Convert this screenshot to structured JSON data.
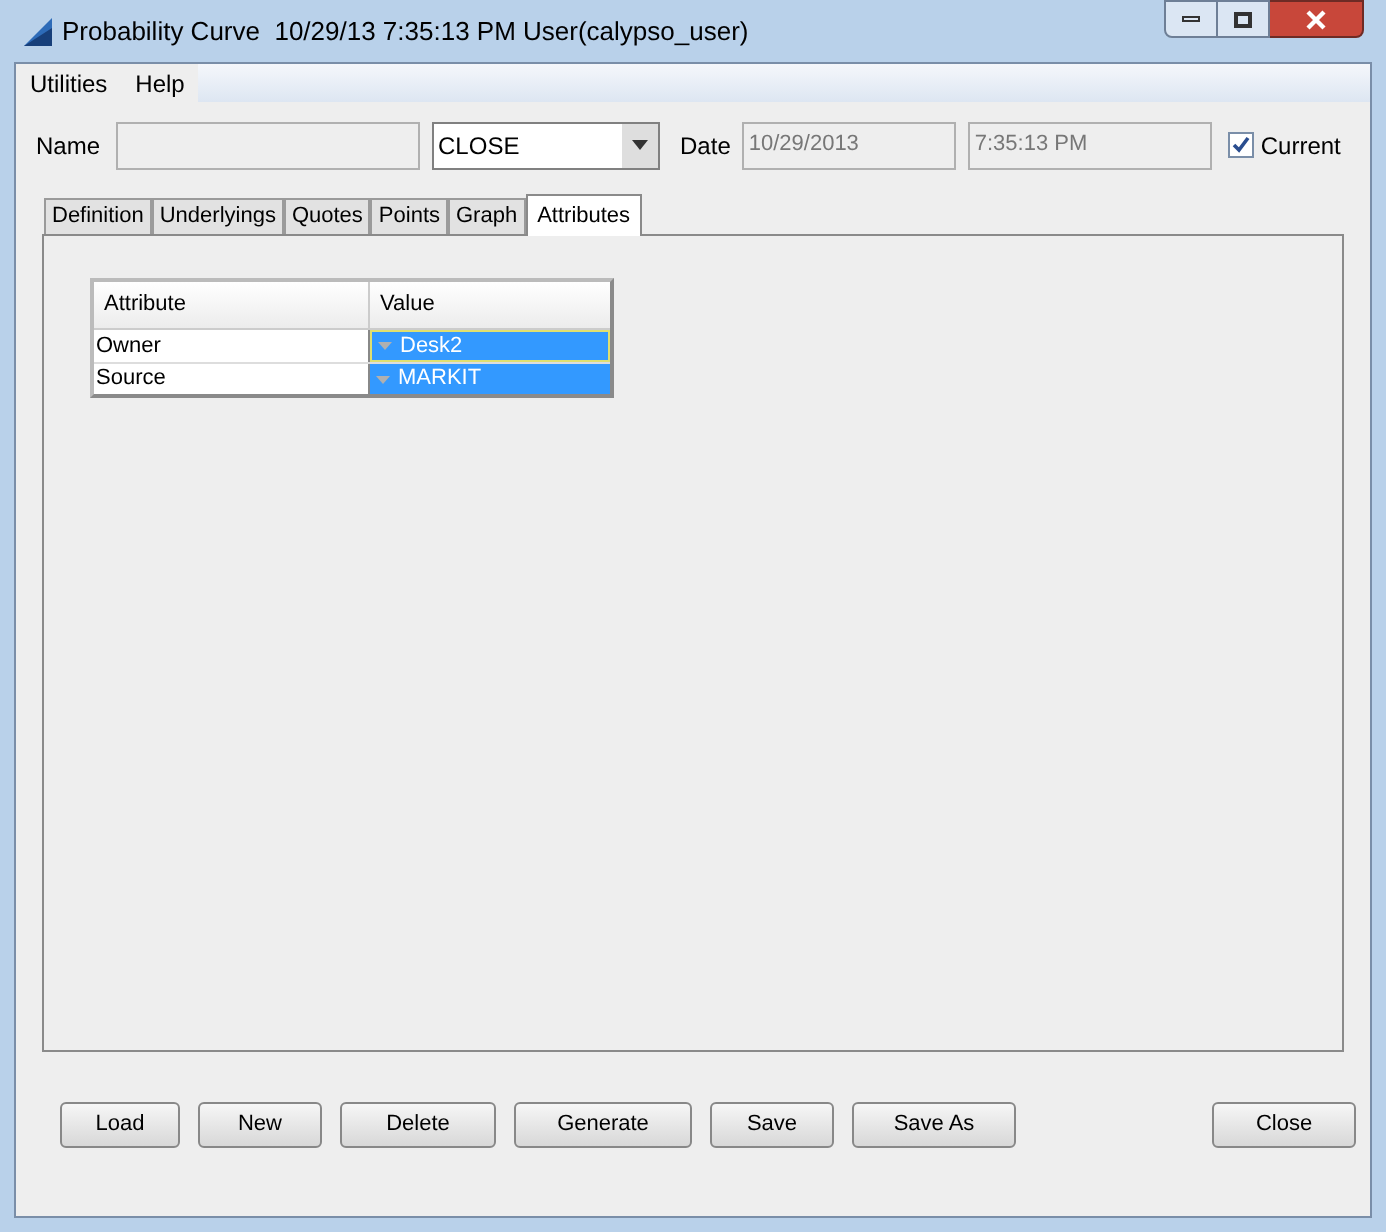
{
  "window": {
    "title": "Probability Curve  10/29/13 7:35:13 PM User(calypso_user)"
  },
  "menu": [
    "Utilities",
    "Help"
  ],
  "form": {
    "name_label": "Name",
    "type_value": "CLOSE",
    "date_label": "Date",
    "date_value": "10/29/2013",
    "time_value": "7:35:13 PM",
    "current": {
      "label": "Current",
      "checked": true
    }
  },
  "tabs": [
    {
      "label": "Definition",
      "selected": false
    },
    {
      "label": "Underlyings",
      "selected": false
    },
    {
      "label": "Quotes",
      "selected": false
    },
    {
      "label": "Points",
      "selected": false
    },
    {
      "label": "Graph",
      "selected": false
    },
    {
      "label": "Attributes",
      "selected": true
    }
  ],
  "table": {
    "columns": [
      "Attribute",
      "Value"
    ],
    "rows": [
      {
        "attribute": "Owner",
        "value": "Desk2",
        "selected": true
      },
      {
        "attribute": "Source",
        "value": "MARKIT",
        "selected": true
      }
    ]
  },
  "buttons": [
    "Load",
    "New",
    "Delete",
    "Generate",
    "Save",
    "Save As"
  ],
  "close_button": "Close"
}
